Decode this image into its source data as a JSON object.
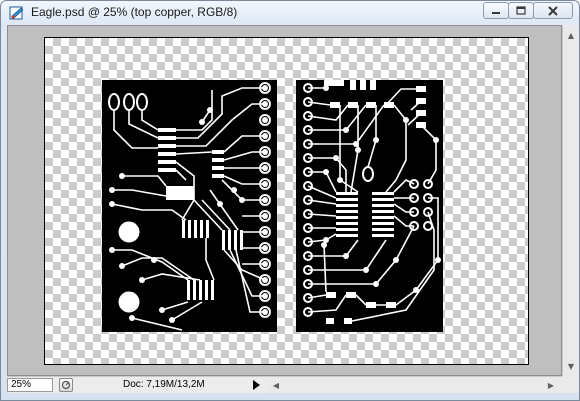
{
  "window": {
    "title": "Eagle.psd @ 25% (top copper, RGB/8)",
    "buttons": {
      "minimize_icon": "minimize-icon",
      "maximize_icon": "maximize-icon",
      "close_icon": "close-icon"
    }
  },
  "canvas": {
    "background": "transparency-checkerboard",
    "layer": "top copper",
    "colors": {
      "copper": "#ffffff",
      "board": "#000000"
    }
  },
  "statusbar": {
    "zoom": "25%",
    "doc_info": "Doc: 7,19M/13,2M"
  }
}
